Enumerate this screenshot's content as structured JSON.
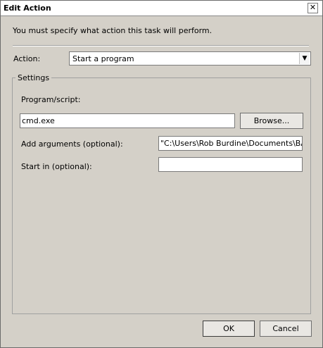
{
  "window": {
    "title": "Edit Action",
    "close_glyph": "✕"
  },
  "info_text": "You must specify what action this task will perform.",
  "action": {
    "label": "Action:",
    "value": "Start a program",
    "arrow": "▼"
  },
  "settings": {
    "group_title": "Settings",
    "program_label": "Program/script:",
    "program_value": "cmd.exe",
    "browse_label": "Browse...",
    "args_label": "Add arguments (optional):",
    "args_value": "\"C:\\Users\\Rob Burdine\\Documents\\BA",
    "start_label": "Start in (optional):",
    "start_value": ""
  },
  "buttons": {
    "ok": "OK",
    "cancel": "Cancel"
  }
}
